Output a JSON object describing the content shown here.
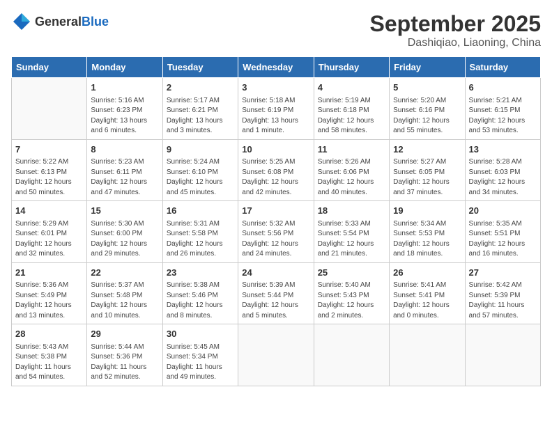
{
  "header": {
    "logo_general": "General",
    "logo_blue": "Blue",
    "title": "September 2025",
    "location": "Dashiqiao, Liaoning, China"
  },
  "days_of_week": [
    "Sunday",
    "Monday",
    "Tuesday",
    "Wednesday",
    "Thursday",
    "Friday",
    "Saturday"
  ],
  "weeks": [
    [
      {
        "day": "",
        "info": ""
      },
      {
        "day": "1",
        "info": "Sunrise: 5:16 AM\nSunset: 6:23 PM\nDaylight: 13 hours\nand 6 minutes."
      },
      {
        "day": "2",
        "info": "Sunrise: 5:17 AM\nSunset: 6:21 PM\nDaylight: 13 hours\nand 3 minutes."
      },
      {
        "day": "3",
        "info": "Sunrise: 5:18 AM\nSunset: 6:19 PM\nDaylight: 13 hours\nand 1 minute."
      },
      {
        "day": "4",
        "info": "Sunrise: 5:19 AM\nSunset: 6:18 PM\nDaylight: 12 hours\nand 58 minutes."
      },
      {
        "day": "5",
        "info": "Sunrise: 5:20 AM\nSunset: 6:16 PM\nDaylight: 12 hours\nand 55 minutes."
      },
      {
        "day": "6",
        "info": "Sunrise: 5:21 AM\nSunset: 6:15 PM\nDaylight: 12 hours\nand 53 minutes."
      }
    ],
    [
      {
        "day": "7",
        "info": "Sunrise: 5:22 AM\nSunset: 6:13 PM\nDaylight: 12 hours\nand 50 minutes."
      },
      {
        "day": "8",
        "info": "Sunrise: 5:23 AM\nSunset: 6:11 PM\nDaylight: 12 hours\nand 47 minutes."
      },
      {
        "day": "9",
        "info": "Sunrise: 5:24 AM\nSunset: 6:10 PM\nDaylight: 12 hours\nand 45 minutes."
      },
      {
        "day": "10",
        "info": "Sunrise: 5:25 AM\nSunset: 6:08 PM\nDaylight: 12 hours\nand 42 minutes."
      },
      {
        "day": "11",
        "info": "Sunrise: 5:26 AM\nSunset: 6:06 PM\nDaylight: 12 hours\nand 40 minutes."
      },
      {
        "day": "12",
        "info": "Sunrise: 5:27 AM\nSunset: 6:05 PM\nDaylight: 12 hours\nand 37 minutes."
      },
      {
        "day": "13",
        "info": "Sunrise: 5:28 AM\nSunset: 6:03 PM\nDaylight: 12 hours\nand 34 minutes."
      }
    ],
    [
      {
        "day": "14",
        "info": "Sunrise: 5:29 AM\nSunset: 6:01 PM\nDaylight: 12 hours\nand 32 minutes."
      },
      {
        "day": "15",
        "info": "Sunrise: 5:30 AM\nSunset: 6:00 PM\nDaylight: 12 hours\nand 29 minutes."
      },
      {
        "day": "16",
        "info": "Sunrise: 5:31 AM\nSunset: 5:58 PM\nDaylight: 12 hours\nand 26 minutes."
      },
      {
        "day": "17",
        "info": "Sunrise: 5:32 AM\nSunset: 5:56 PM\nDaylight: 12 hours\nand 24 minutes."
      },
      {
        "day": "18",
        "info": "Sunrise: 5:33 AM\nSunset: 5:54 PM\nDaylight: 12 hours\nand 21 minutes."
      },
      {
        "day": "19",
        "info": "Sunrise: 5:34 AM\nSunset: 5:53 PM\nDaylight: 12 hours\nand 18 minutes."
      },
      {
        "day": "20",
        "info": "Sunrise: 5:35 AM\nSunset: 5:51 PM\nDaylight: 12 hours\nand 16 minutes."
      }
    ],
    [
      {
        "day": "21",
        "info": "Sunrise: 5:36 AM\nSunset: 5:49 PM\nDaylight: 12 hours\nand 13 minutes."
      },
      {
        "day": "22",
        "info": "Sunrise: 5:37 AM\nSunset: 5:48 PM\nDaylight: 12 hours\nand 10 minutes."
      },
      {
        "day": "23",
        "info": "Sunrise: 5:38 AM\nSunset: 5:46 PM\nDaylight: 12 hours\nand 8 minutes."
      },
      {
        "day": "24",
        "info": "Sunrise: 5:39 AM\nSunset: 5:44 PM\nDaylight: 12 hours\nand 5 minutes."
      },
      {
        "day": "25",
        "info": "Sunrise: 5:40 AM\nSunset: 5:43 PM\nDaylight: 12 hours\nand 2 minutes."
      },
      {
        "day": "26",
        "info": "Sunrise: 5:41 AM\nSunset: 5:41 PM\nDaylight: 12 hours\nand 0 minutes."
      },
      {
        "day": "27",
        "info": "Sunrise: 5:42 AM\nSunset: 5:39 PM\nDaylight: 11 hours\nand 57 minutes."
      }
    ],
    [
      {
        "day": "28",
        "info": "Sunrise: 5:43 AM\nSunset: 5:38 PM\nDaylight: 11 hours\nand 54 minutes."
      },
      {
        "day": "29",
        "info": "Sunrise: 5:44 AM\nSunset: 5:36 PM\nDaylight: 11 hours\nand 52 minutes."
      },
      {
        "day": "30",
        "info": "Sunrise: 5:45 AM\nSunset: 5:34 PM\nDaylight: 11 hours\nand 49 minutes."
      },
      {
        "day": "",
        "info": ""
      },
      {
        "day": "",
        "info": ""
      },
      {
        "day": "",
        "info": ""
      },
      {
        "day": "",
        "info": ""
      }
    ]
  ]
}
